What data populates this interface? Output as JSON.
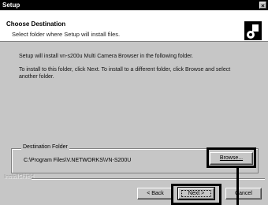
{
  "window": {
    "title": "Setup",
    "close_glyph": "×"
  },
  "header": {
    "title": "Choose Destination",
    "subtitle": "Select folder where Setup will install files.",
    "logo_icon": "setup-disc-icon"
  },
  "body": {
    "line1": "Setup will install vn-s200u Multi Camera Browser in the following folder.",
    "line2a": "To install to this folder, click Next. To install to a different folder, click Browse and select",
    "line2b": "another folder."
  },
  "destination": {
    "legend": "Destination Folder",
    "path": "C:\\Program Files\\V.NETWORKS\\VN-S200U",
    "browse_label": "Browse..."
  },
  "footer": {
    "brand": "InstallShield",
    "back_label": "< Back",
    "next_label": "Next >",
    "cancel_label": "Cancel"
  }
}
